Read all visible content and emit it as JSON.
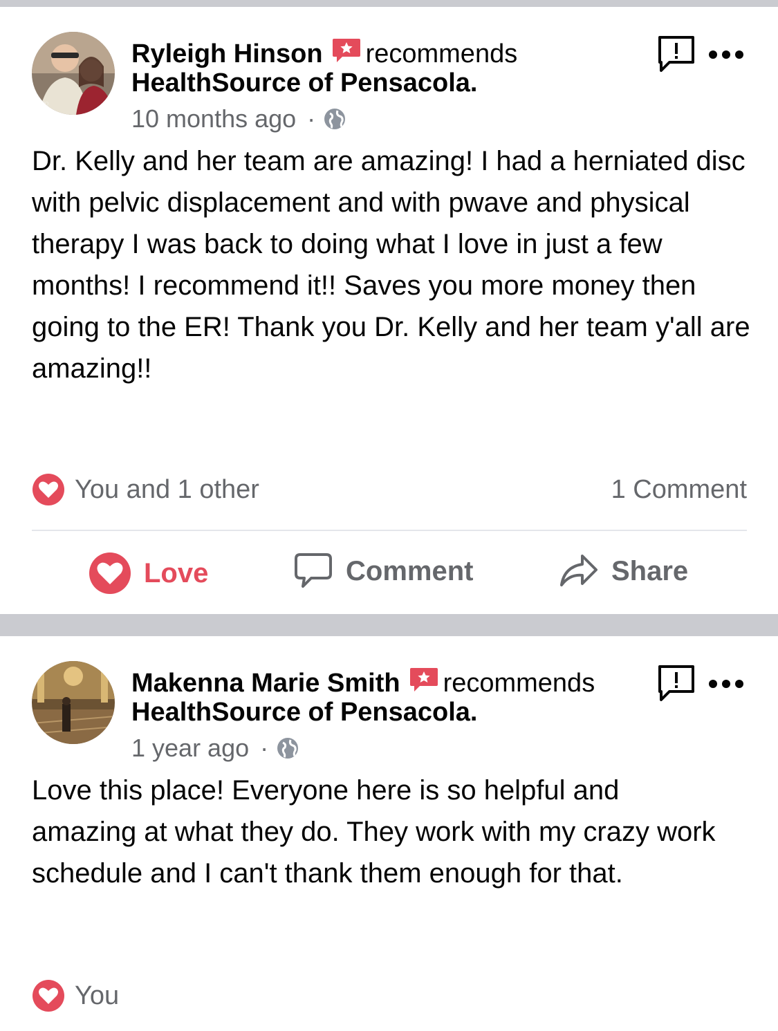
{
  "colors": {
    "love": "#e44b5b",
    "recommend": "#e44b5b",
    "muted_text": "#65676b",
    "separator": "#cacbd0"
  },
  "posts": [
    {
      "author": "Ryleigh Hinson",
      "recommends_word": "recommends",
      "page": "HealthSource of Pensacola.",
      "time": "10 months ago",
      "separator_dot": "·",
      "privacy_icon": "globe-icon",
      "text": "Dr. Kelly and her team are amazing! I had a herniated disc with pelvic displacement and with pwave and physical therapy I was back to doing what I love in just a few months! I recommend it!! Saves you more money then going to the ER! Thank you Dr. Kelly and her team y'all are amazing!!",
      "reactions": "You and 1 other",
      "comments": "1 Comment",
      "actions": {
        "love": "Love",
        "comment": "Comment",
        "share": "Share"
      }
    },
    {
      "author": "Makenna Marie Smith",
      "recommends_word": "recommends",
      "page": "HealthSource of Pensacola.",
      "time": "1 year ago",
      "separator_dot": "·",
      "privacy_icon": "globe-icon",
      "text": "Love this place! Everyone here is so helpful and amazing at what they do. They work with my crazy work schedule and I can't thank them enough for that.",
      "reactions": "You"
    }
  ]
}
